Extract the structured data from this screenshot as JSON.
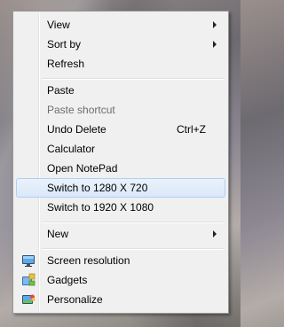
{
  "menu": {
    "items": [
      {
        "label": "View",
        "submenu": true
      },
      {
        "label": "Sort by",
        "submenu": true
      },
      {
        "label": "Refresh"
      },
      {
        "label": "Paste"
      },
      {
        "label": "Paste shortcut",
        "disabled": true
      },
      {
        "label": "Undo Delete",
        "shortcut": "Ctrl+Z"
      },
      {
        "label": "Calculator"
      },
      {
        "label": "Open NotePad"
      },
      {
        "label": "Switch to 1280 X 720",
        "highlighted": true
      },
      {
        "label": "Switch to 1920 X 1080"
      },
      {
        "label": "New",
        "submenu": true
      },
      {
        "label": "Screen resolution",
        "icon": "monitor-icon"
      },
      {
        "label": "Gadgets",
        "icon": "gadgets-icon"
      },
      {
        "label": "Personalize",
        "icon": "personalize-icon"
      }
    ]
  },
  "colors": {
    "menu_background": "#f0f0f0",
    "highlight_border": "#aecff7",
    "disabled_text": "#6d6d6d"
  }
}
